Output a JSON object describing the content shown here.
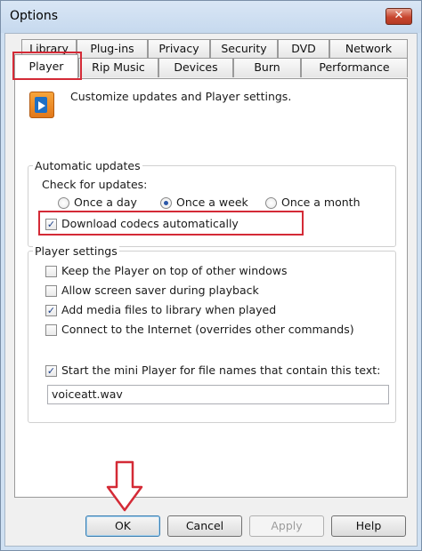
{
  "window": {
    "title": "Options",
    "close_glyph": "✕"
  },
  "tabs_row1": [
    "Library",
    "Plug-ins",
    "Privacy",
    "Security",
    "DVD",
    "Network"
  ],
  "tabs_row2": [
    "Player",
    "Rip Music",
    "Devices",
    "Burn",
    "Performance"
  ],
  "active_tab": "Player",
  "header": {
    "description": "Customize updates and Player settings.",
    "icon": "media-player-icon"
  },
  "automatic_updates": {
    "label": "Automatic updates",
    "check_label": "Check for updates:",
    "options": [
      {
        "label": "Once a day",
        "selected": false
      },
      {
        "label": "Once a week",
        "selected": true
      },
      {
        "label": "Once a month",
        "selected": false
      }
    ],
    "download_codecs": {
      "label": "Download codecs automatically",
      "checked": true
    }
  },
  "player_settings": {
    "label": "Player settings",
    "items": [
      {
        "label": "Keep the Player on top of other windows",
        "checked": false
      },
      {
        "label": "Allow screen saver during playback",
        "checked": false
      },
      {
        "label": "Add media files to library when played",
        "checked": true
      },
      {
        "label": "Connect to the Internet (overrides other commands)",
        "checked": false
      }
    ],
    "mini_player": {
      "label": "Start the mini Player for file names that contain this text:",
      "checked": true,
      "value": "voiceatt.wav"
    }
  },
  "buttons": {
    "ok": "OK",
    "cancel": "Cancel",
    "apply": "Apply",
    "help": "Help"
  },
  "colors": {
    "highlight": "#d42a36",
    "accent": "#2b57a8"
  }
}
